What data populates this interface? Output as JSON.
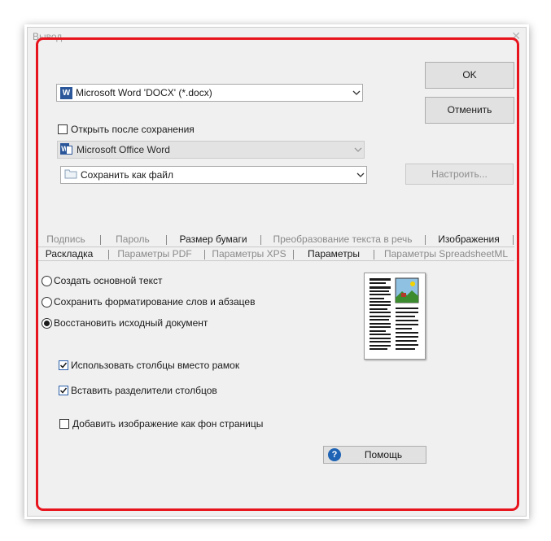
{
  "dialog": {
    "title": "Вывод",
    "close": "✕"
  },
  "buttons": {
    "ok": "OK",
    "cancel": "Отменить",
    "configure": "Настроить...",
    "help": "Помощь"
  },
  "format_select": {
    "value": "Microsoft Word 'DOCX' (*.docx)",
    "icon": "word-doc-icon"
  },
  "open_after_save": {
    "label": "Открыть после сохранения",
    "checked": false
  },
  "app_select": {
    "value": "Microsoft Office Word",
    "icon": "word-app-icon",
    "disabled": true
  },
  "save_as_select": {
    "value": "Сохранить как файл",
    "icon": "folder-icon"
  },
  "tabs_row1": [
    {
      "label": "Подпись",
      "active": false
    },
    {
      "label": "Пароль",
      "active": false
    },
    {
      "label": "Размер бумаги",
      "active": true
    },
    {
      "label": "Преобразование текста в речь",
      "active": false
    },
    {
      "label": "Изображения",
      "active": true
    }
  ],
  "tabs_row2": [
    {
      "label": "Раскладка",
      "active": true
    },
    {
      "label": "Параметры PDF",
      "active": false
    },
    {
      "label": "Параметры XPS",
      "active": false
    },
    {
      "label": "Параметры",
      "active": true
    },
    {
      "label": "Параметры SpreadsheetML",
      "active": false
    }
  ],
  "radios": [
    {
      "label": "Создать основной текст",
      "selected": false
    },
    {
      "label": "Сохранить форматирование слов и абзацев",
      "selected": false
    },
    {
      "label": "Восстановить исходный документ",
      "selected": true
    }
  ],
  "checkboxes": [
    {
      "label": "Использовать столбцы вместо рамок",
      "checked": true
    },
    {
      "label": "Вставить разделители столбцов",
      "checked": true
    },
    {
      "label": "Добавить изображение как фон страницы",
      "checked": false
    }
  ],
  "colors": {
    "highlight_frame": "#e8141d",
    "check_blue": "#2a5fa8",
    "help_icon_blue": "#1e63b4",
    "word_blue": "#2b579a"
  }
}
